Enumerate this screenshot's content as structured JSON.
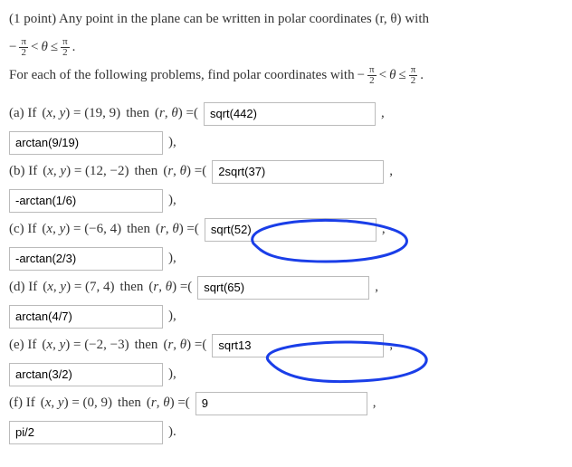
{
  "header": {
    "points": "(1 point) Any point in the plane can be written in polar coordinates",
    "rtheta": "(r, θ)",
    "with": "with",
    "range_lhs": "−",
    "range_lt": "<",
    "theta": "θ",
    "range_le": "≤",
    "pi": "π",
    "two": "2",
    "dot": "."
  },
  "instruction": {
    "text": "For each of the following problems, find polar coordinates with",
    "minus": "−"
  },
  "parts": [
    {
      "label": "(a) If",
      "xy": "(x, y) = (19, 9)",
      "then": "then",
      "lead": "(r, θ) =(",
      "r": "sqrt(442)",
      "theta": "arctan(9/19)",
      "end": "),"
    },
    {
      "label": "(b) If",
      "xy": "(x, y) = (12, −2)",
      "then": "then",
      "lead": "(r, θ) =(",
      "r": "2sqrt(37)",
      "theta": "-arctan(1/6)",
      "end": "),"
    },
    {
      "label": "(c) If",
      "xy": "(x, y) = (−6, 4)",
      "then": "then",
      "lead": "(r, θ) =(",
      "r": "sqrt(52)",
      "theta": "-arctan(2/3)",
      "end": "),"
    },
    {
      "label": "(d) If",
      "xy": "(x, y) = (7, 4)",
      "then": "then",
      "lead": "(r, θ) =(",
      "r": "sqrt(65)",
      "theta": "arctan(4/7)",
      "end": "),"
    },
    {
      "label": "(e) If",
      "xy": "(x, y) = (−2, −3)",
      "then": "then",
      "lead": "(r, θ) =(",
      "r": "sqrt13",
      "theta": "arctan(3/2)",
      "end": "),"
    },
    {
      "label": "(f) If",
      "xy": "(x, y) = (0, 9)",
      "then": "then",
      "lead": "(r, θ) =(",
      "r": "9",
      "theta": "pi/2",
      "end": ")."
    }
  ],
  "annotation": {
    "stroke": "#1a3ee8"
  }
}
